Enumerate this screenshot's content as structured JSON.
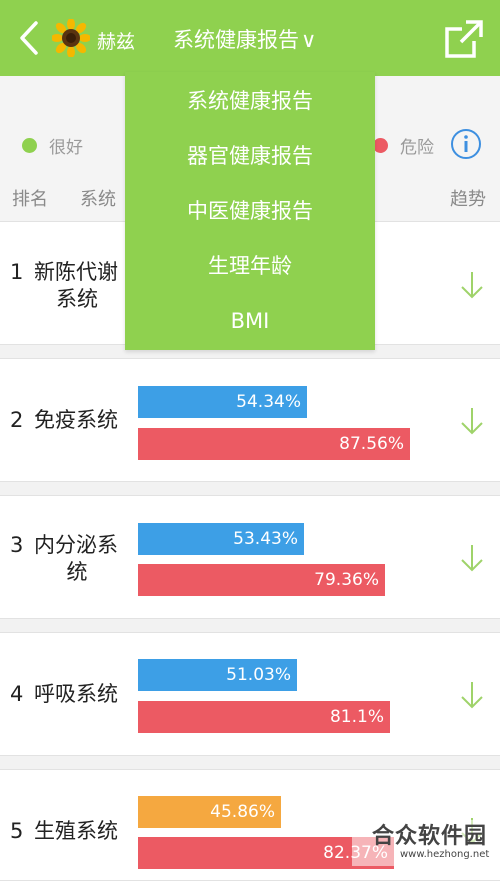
{
  "header": {
    "user_name": "赫兹",
    "report_title": "系统健康报告",
    "chevron": "∨",
    "back_icon": "chevron-left-icon",
    "share_icon": "share-icon",
    "background_color": "#8fd14f"
  },
  "legend": {
    "good_label": "很好",
    "good_color": "#8fd14f",
    "danger_label": "危险",
    "danger_color": "#ec5a63",
    "info_icon": "info-icon"
  },
  "table_headers": {
    "rank": "排名",
    "system": "系统",
    "trend": "趋势"
  },
  "dropdown": {
    "items": [
      "系统健康报告",
      "器官健康报告",
      "中医健康报告",
      "生理年龄",
      "BMI"
    ]
  },
  "rows": [
    {
      "rank": "1",
      "name_line1": "新陈代谢",
      "name_line2": "系统",
      "bar_current": "",
      "bar_reference": "",
      "trend_icon": "arrow-down-icon"
    },
    {
      "rank": "2",
      "name_line1": "免疫系统",
      "name_line2": "",
      "bar_current": "54.34%",
      "bar_reference": "87.56%",
      "current_color": "#3d9fe6",
      "trend_icon": "arrow-down-icon"
    },
    {
      "rank": "3",
      "name_line1": "内分泌系",
      "name_line2": "统",
      "bar_current": "53.43%",
      "bar_reference": "79.36%",
      "current_color": "#3d9fe6",
      "trend_icon": "arrow-down-icon"
    },
    {
      "rank": "4",
      "name_line1": "呼吸系统",
      "name_line2": "",
      "bar_current": "51.03%",
      "bar_reference": "81.1%",
      "current_color": "#3d9fe6",
      "trend_icon": "arrow-down-icon"
    },
    {
      "rank": "5",
      "name_line1": "生殖系统",
      "name_line2": "",
      "bar_current": "45.86%",
      "bar_reference": "82.37%",
      "current_color": "#f5a840",
      "trend_icon": "arrow-down-icon"
    }
  ],
  "watermark": {
    "text": "合众软件园",
    "url": "www.hezhong.net"
  }
}
